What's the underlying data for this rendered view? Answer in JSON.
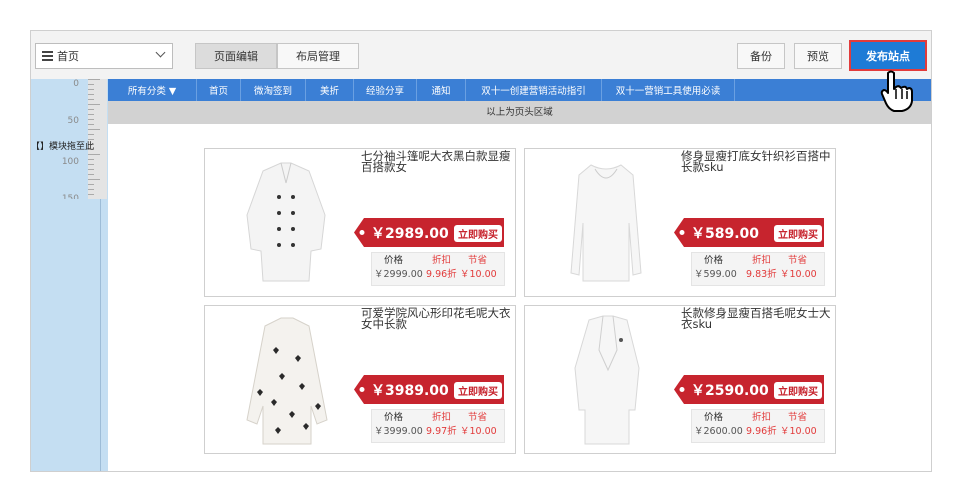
{
  "toolbar": {
    "page_select": "首页",
    "tab_page_edit": "页面编辑",
    "tab_layout": "布局管理",
    "backup": "备份",
    "preview": "预览",
    "publish": "发布站点"
  },
  "ruler": {
    "marks": [
      "0",
      "50",
      "100",
      "150"
    ],
    "side_label": "【】模块拖至此"
  },
  "nav": {
    "items": [
      "所有分类 ▼",
      "首页",
      "微淘签到",
      "美折",
      "经验分享",
      "通知",
      "双十一创建营销活动指引",
      "双十一营销工具使用必读"
    ]
  },
  "header_note": "以上为页头区域",
  "price_labels": {
    "price": "价格",
    "discount": "折扣",
    "save": "节省",
    "buy": "立即购买"
  },
  "products": [
    {
      "title": "七分袖斗篷呢大衣黑白款显瘦百搭款女",
      "price": "￥2989.00",
      "orig": "￥2999.00",
      "discount": "9.96折",
      "save": "￥10.00"
    },
    {
      "title": "修身显瘦打底女针织衫百搭中长款sku",
      "price": "￥589.00",
      "orig": "￥599.00",
      "discount": "9.83折",
      "save": "￥10.00"
    },
    {
      "title": "可爱学院风心形印花毛呢大衣女中长款",
      "price": "￥3989.00",
      "orig": "￥3999.00",
      "discount": "9.97折",
      "save": "￥10.00"
    },
    {
      "title": "长款修身显瘦百搭毛呢女士大衣sku",
      "price": "￥2590.00",
      "orig": "￥2600.00",
      "discount": "9.96折",
      "save": "￥10.00"
    }
  ],
  "colors": {
    "nav_blue": "#3b7fd5",
    "publish_blue": "#1e7bd6",
    "tag_red": "#c7242e",
    "highlight_red": "#e23b3b"
  }
}
